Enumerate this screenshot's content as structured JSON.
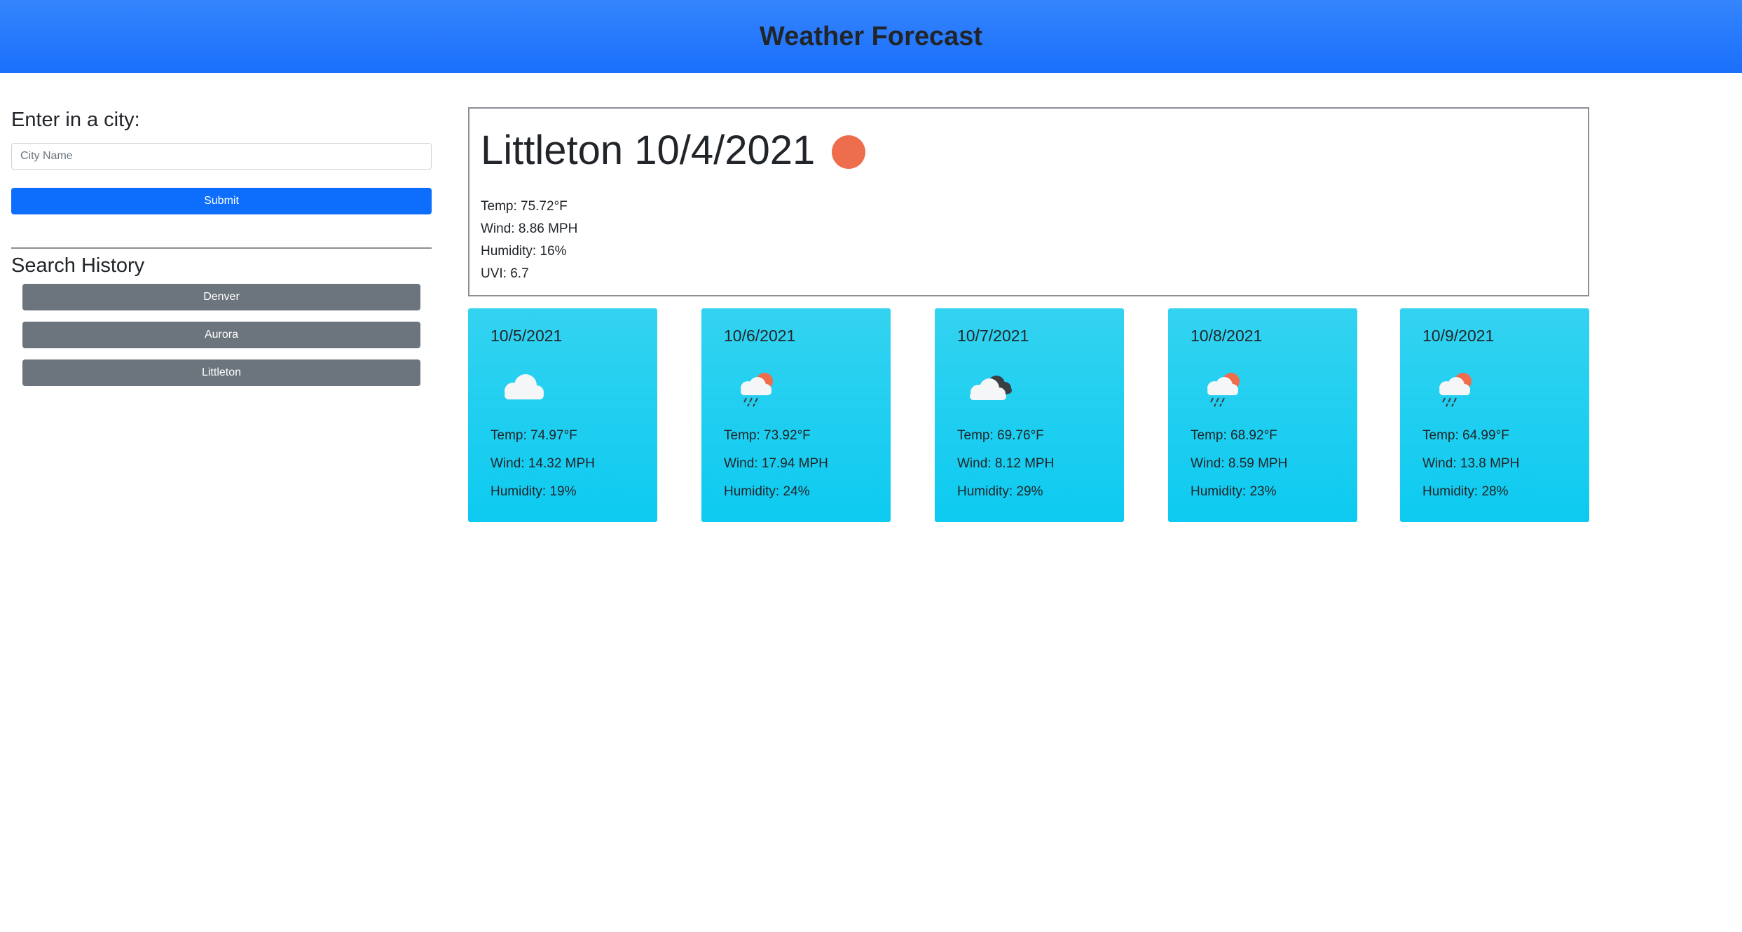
{
  "header": {
    "title": "Weather Forecast"
  },
  "search": {
    "label": "Enter in a city:",
    "placeholder": "City Name",
    "value": "",
    "submit_label": "Submit"
  },
  "history": {
    "title": "Search History",
    "items": [
      "Denver",
      "Aurora",
      "Littleton"
    ]
  },
  "current": {
    "city": "Littleton",
    "date": "10/4/2021",
    "title": "Littleton 10/4/2021",
    "icon": "sun-icon",
    "temp": "Temp: 75.72°F",
    "wind": "Wind: 8.86 MPH",
    "humidity": "Humidity: 16%",
    "uvi": "UVI: 6.7"
  },
  "forecast": [
    {
      "date": "10/5/2021",
      "icon": "cloud-icon",
      "temp": "Temp: 74.97°F",
      "wind": "Wind: 14.32 MPH",
      "humidity": "Humidity: 19%"
    },
    {
      "date": "10/6/2021",
      "icon": "sun-rain-icon",
      "temp": "Temp: 73.92°F",
      "wind": "Wind: 17.94 MPH",
      "humidity": "Humidity: 24%"
    },
    {
      "date": "10/7/2021",
      "icon": "broken-clouds-icon",
      "temp": "Temp: 69.76°F",
      "wind": "Wind: 8.12 MPH",
      "humidity": "Humidity: 29%"
    },
    {
      "date": "10/8/2021",
      "icon": "sun-rain-icon",
      "temp": "Temp: 68.92°F",
      "wind": "Wind: 8.59 MPH",
      "humidity": "Humidity: 23%"
    },
    {
      "date": "10/9/2021",
      "icon": "sun-rain-icon",
      "temp": "Temp: 64.99°F",
      "wind": "Wind: 13.8 MPH",
      "humidity": "Humidity: 28%"
    }
  ],
  "colors": {
    "header": "#1a6ffc",
    "submit": "#0d6efd",
    "history_button": "#6c757d",
    "card": "#0dcaf0",
    "sun": "#ee6d4c"
  }
}
